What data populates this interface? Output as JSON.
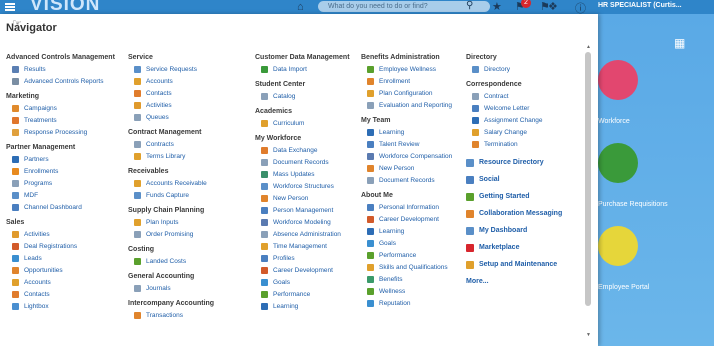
{
  "topbar": {
    "brand": "VISION",
    "search_placeholder": "What do you need to do or find?",
    "notification_count": "2",
    "user": "HR SPECIALIST (Curtis...",
    "icons": [
      "menu-icon",
      "home-icon",
      "search-icon",
      "favorites-star-icon",
      "flag-icon",
      "bell-icon",
      "accessibility-icon",
      "help-icon"
    ]
  },
  "navigator": {
    "title": "Navigator",
    "columns": [
      {
        "groups": [
          {
            "title": "Advanced Controls Management",
            "items": [
              {
                "label": "Results",
                "color": "#5b7fb3"
              },
              {
                "label": "Advanced Controls Reports",
                "color": "#7a8ea3"
              }
            ]
          },
          {
            "title": "Marketing",
            "items": [
              {
                "label": "Campaigns",
                "color": "#e08a2c"
              },
              {
                "label": "Treatments",
                "color": "#e0762c"
              },
              {
                "label": "Response Processing",
                "color": "#e0a03c"
              }
            ]
          },
          {
            "title": "Partner Management",
            "items": [
              {
                "label": "Partners",
                "color": "#2d6db5"
              },
              {
                "label": "Enrollments",
                "color": "#e88a1e"
              },
              {
                "label": "Programs",
                "color": "#8aa0b8"
              },
              {
                "label": "MDF",
                "color": "#5a8fc8"
              },
              {
                "label": "Channel Dashboard",
                "color": "#4a7fc0"
              }
            ]
          },
          {
            "title": "Sales",
            "items": [
              {
                "label": "Activities",
                "color": "#e09a2c"
              },
              {
                "label": "Deal Registrations",
                "color": "#d25a2a"
              },
              {
                "label": "Leads",
                "color": "#3a8fd0"
              },
              {
                "label": "Opportunities",
                "color": "#e0842c"
              },
              {
                "label": "Accounts",
                "color": "#e0a02c"
              },
              {
                "label": "Contacts",
                "color": "#e07c2c"
              },
              {
                "label": "Lightbox",
                "color": "#4a8fd0"
              }
            ]
          }
        ]
      },
      {
        "groups": [
          {
            "title": "Service",
            "items": [
              {
                "label": "Service Requests",
                "color": "#5a8fc8"
              },
              {
                "label": "Accounts",
                "color": "#e0a02c"
              },
              {
                "label": "Contacts",
                "color": "#e07c2c"
              },
              {
                "label": "Activities",
                "color": "#e09a2c"
              },
              {
                "label": "Queues",
                "color": "#8aa0b8"
              }
            ]
          },
          {
            "title": "Contract Management",
            "items": [
              {
                "label": "Contracts",
                "color": "#8aa0b8"
              },
              {
                "label": "Terms Library",
                "color": "#e0a02c"
              }
            ]
          },
          {
            "title": "Receivables",
            "items": [
              {
                "label": "Accounts Receivable",
                "color": "#e0a02c"
              },
              {
                "label": "Funds Capture",
                "color": "#5a8fc8"
              }
            ]
          },
          {
            "title": "Supply Chain Planning",
            "items": [
              {
                "label": "Plan Inputs",
                "color": "#e0a02c"
              },
              {
                "label": "Order Promising",
                "color": "#8aa0b8"
              }
            ]
          },
          {
            "title": "Costing",
            "items": [
              {
                "label": "Landed Costs",
                "color": "#5aa02c"
              }
            ]
          },
          {
            "title": "General Accounting",
            "items": [
              {
                "label": "Journals",
                "color": "#8aa0b8"
              }
            ]
          },
          {
            "title": "Intercompany Accounting",
            "items": [
              {
                "label": "Transactions",
                "color": "#e0842c"
              }
            ]
          }
        ]
      },
      {
        "groups": [
          {
            "title": "Customer Data Management",
            "items": [
              {
                "label": "Data Import",
                "color": "#3a9a3a"
              }
            ]
          },
          {
            "title": "Student Center",
            "items": [
              {
                "label": "Catalog",
                "color": "#8aa0b8"
              }
            ]
          },
          {
            "title": "Academics",
            "items": [
              {
                "label": "Curriculum",
                "color": "#e0a02c"
              }
            ]
          },
          {
            "title": "My Workforce",
            "items": [
              {
                "label": "Data Exchange",
                "color": "#e07c2c"
              },
              {
                "label": "Document Records",
                "color": "#8aa0b8"
              },
              {
                "label": "Mass Updates",
                "color": "#3a8f6a"
              },
              {
                "label": "Workforce Structures",
                "color": "#5a8fc8"
              },
              {
                "label": "New Person",
                "color": "#e0842c"
              },
              {
                "label": "Person Management",
                "color": "#4a7fc0"
              },
              {
                "label": "Workforce Modeling",
                "color": "#5a7ab0"
              },
              {
                "label": "Absence Administration",
                "color": "#8aa0b8"
              },
              {
                "label": "Time Management",
                "color": "#e0a02c"
              },
              {
                "label": "Profiles",
                "color": "#4a7fc0"
              },
              {
                "label": "Career Development",
                "color": "#d25a2a"
              },
              {
                "label": "Goals",
                "color": "#3a8fd0"
              },
              {
                "label": "Performance",
                "color": "#5aa02c"
              },
              {
                "label": "Learning",
                "color": "#2d6db5"
              }
            ]
          }
        ]
      },
      {
        "groups": [
          {
            "title": "Benefits Administration",
            "items": [
              {
                "label": "Employee Wellness",
                "color": "#5aa02c"
              },
              {
                "label": "Enrollment",
                "color": "#e0842c"
              },
              {
                "label": "Plan Configuration",
                "color": "#e0a02c"
              },
              {
                "label": "Evaluation and Reporting",
                "color": "#8aa0b8"
              }
            ]
          },
          {
            "title": "My Team",
            "items": [
              {
                "label": "Learning",
                "color": "#2d6db5"
              },
              {
                "label": "Talent Review",
                "color": "#4a7fc0"
              },
              {
                "label": "Workforce Compensation",
                "color": "#5a7ab0"
              },
              {
                "label": "New Person",
                "color": "#e0842c"
              },
              {
                "label": "Document Records",
                "color": "#8aa0b8"
              }
            ]
          },
          {
            "title": "About Me",
            "items": [
              {
                "label": "Personal Information",
                "color": "#4a7fc0"
              },
              {
                "label": "Career Development",
                "color": "#d25a2a"
              },
              {
                "label": "Learning",
                "color": "#2d6db5"
              },
              {
                "label": "Goals",
                "color": "#3a8fd0"
              },
              {
                "label": "Performance",
                "color": "#5aa02c"
              },
              {
                "label": "Skills and Qualifications",
                "color": "#e0a02c"
              },
              {
                "label": "Benefits",
                "color": "#3a9a6a"
              },
              {
                "label": "Wellness",
                "color": "#5aa02c"
              },
              {
                "label": "Reputation",
                "color": "#3a8fd0"
              }
            ]
          }
        ]
      },
      {
        "groups": [
          {
            "title": "Directory",
            "items": [
              {
                "label": "Directory",
                "color": "#5a8fc8"
              }
            ]
          },
          {
            "title": "Correspondence",
            "items": [
              {
                "label": "Contract",
                "color": "#8aa0b8"
              },
              {
                "label": "Welcome Letter",
                "color": "#4a7fc0"
              },
              {
                "label": "Assignment Change",
                "color": "#2d6db5"
              },
              {
                "label": "Salary Change",
                "color": "#e0a02c"
              },
              {
                "label": "Termination",
                "color": "#e0842c"
              }
            ]
          }
        ],
        "big_items": [
          {
            "label": "Resource Directory",
            "color": "#5a8fc8"
          },
          {
            "label": "Social",
            "color": "#4a7fc0"
          },
          {
            "label": "Getting Started",
            "color": "#5aa02c"
          },
          {
            "label": "Collaboration Messaging",
            "color": "#e0842c"
          },
          {
            "label": "My Dashboard",
            "color": "#5a8fc8"
          },
          {
            "label": "Marketplace",
            "color": "#d7262d"
          },
          {
            "label": "Setup and Maintenance",
            "color": "#e0a02c"
          },
          {
            "label": "More...",
            "color": ""
          }
        ]
      }
    ]
  },
  "right_panel": {
    "tiles": [
      {
        "label": "Workforce",
        "color": "#e2476f"
      },
      {
        "label": "Purchase Requisitions",
        "color": "#3a9a3a"
      },
      {
        "label": "Employee Portal",
        "color": "#e6d63a"
      }
    ]
  }
}
